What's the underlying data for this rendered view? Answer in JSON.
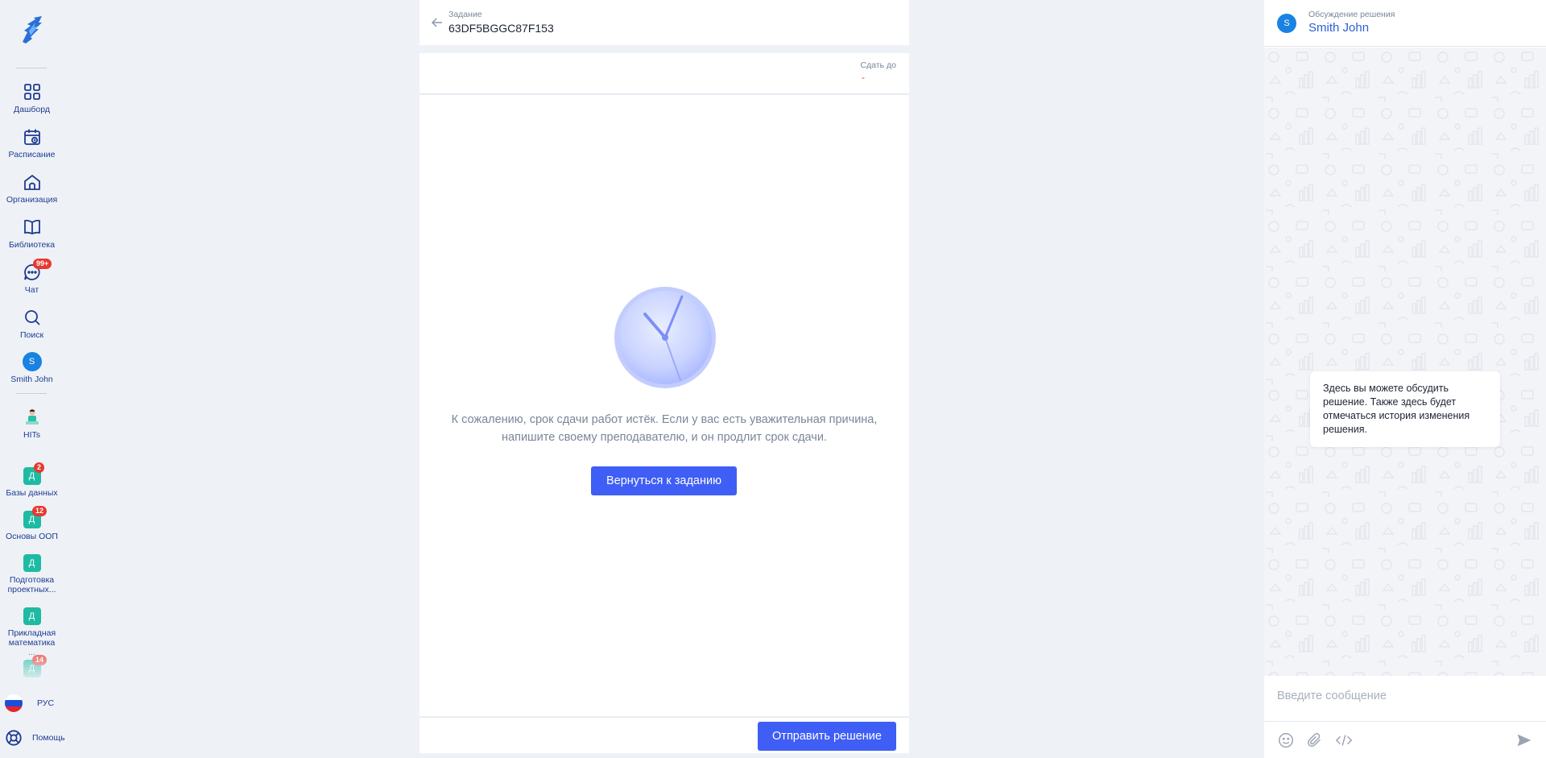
{
  "sidebar": {
    "items": [
      {
        "label": "Дашборд",
        "icon": "dashboard-icon"
      },
      {
        "label": "Расписание",
        "icon": "calendar-icon"
      },
      {
        "label": "Организация",
        "icon": "organization-icon"
      },
      {
        "label": "Библиотека",
        "icon": "book-icon"
      },
      {
        "label": "Чат",
        "icon": "chat-icon",
        "badge": "99+"
      },
      {
        "label": "Поиск",
        "icon": "search-icon"
      },
      {
        "label": "Smith John",
        "avatar_letter": "S"
      },
      {
        "label": "HITs",
        "icon": "hits-icon"
      }
    ],
    "courses": [
      {
        "label": "Базы данных",
        "letter": "Д",
        "badge": "2"
      },
      {
        "label": "Основы ООП",
        "letter": "Д",
        "badge": "12"
      },
      {
        "label": "Подготовка проектных...",
        "letter": "Д"
      },
      {
        "label": "Прикладная математика ...",
        "letter": "Д"
      },
      {
        "letter": "Д",
        "badge": "14"
      }
    ],
    "language": "РУС",
    "help": "Помощь"
  },
  "task": {
    "caption": "Задание",
    "id": "63DF5BGGC87F153",
    "deadline_label": "Сдать до",
    "deadline_value": "-",
    "expired_message_line1": "К сожалению, срок сдачи работ истёк. Если у вас есть уважительная причина,",
    "expired_message_line2": "напишите своему преподавателю, и он продлит срок сдачи.",
    "return_button": "Вернуться к заданию",
    "submit_button": "Отправить решение"
  },
  "chat": {
    "caption": "Обсуждение решения",
    "name": "Smith John",
    "avatar_letter": "S",
    "info_message": "Здесь вы можете обсудить решение. Также здесь будет отмечаться история изменения решения.",
    "input_placeholder": "Введите сообщение"
  },
  "colors": {
    "accent": "#3f5ef5",
    "sidebar_text": "#1f3b8f",
    "badge": "#e8392f",
    "course": "#1ebba3",
    "avatar": "#1a82e2"
  }
}
